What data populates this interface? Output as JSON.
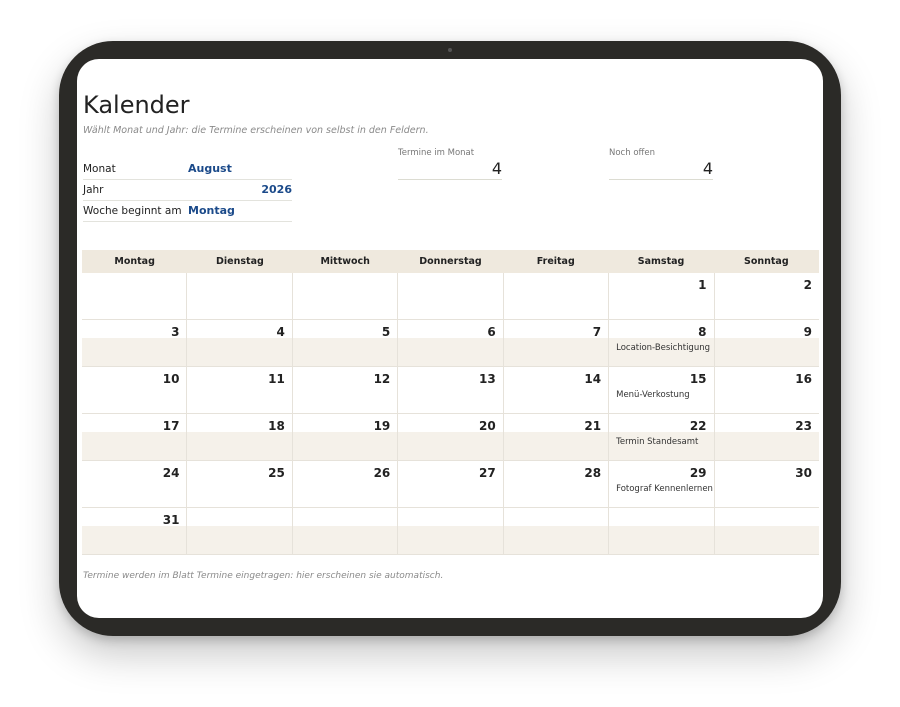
{
  "page": {
    "title": "Kalender",
    "subtitle": "Wählt Monat und Jahr: die Termine erscheinen von selbst in den Feldern.",
    "footer": "Termine werden im Blatt Termine eingetragen: hier erscheinen sie automatisch."
  },
  "fields": {
    "month_label": "Monat",
    "month_value": "August",
    "year_label": "Jahr",
    "year_value": "2026",
    "week_start_label": "Woche beginnt am",
    "week_start_value": "Montag"
  },
  "stats": {
    "appointments_label": "Termine im Monat",
    "appointments_value": "4",
    "open_label": "Noch offen",
    "open_value": "4"
  },
  "calendar": {
    "weekdays": [
      "Montag",
      "Dienstag",
      "Mittwoch",
      "Donnerstag",
      "Freitag",
      "Samstag",
      "Sonntag"
    ],
    "weeks": [
      [
        {
          "d": ""
        },
        {
          "d": ""
        },
        {
          "d": ""
        },
        {
          "d": ""
        },
        {
          "d": ""
        },
        {
          "d": "1"
        },
        {
          "d": "2"
        }
      ],
      [
        {
          "d": "3"
        },
        {
          "d": "4"
        },
        {
          "d": "5"
        },
        {
          "d": "6"
        },
        {
          "d": "7"
        },
        {
          "d": "8",
          "e": "Location-Besichtigung"
        },
        {
          "d": "9"
        }
      ],
      [
        {
          "d": "10"
        },
        {
          "d": "11"
        },
        {
          "d": "12"
        },
        {
          "d": "13"
        },
        {
          "d": "14"
        },
        {
          "d": "15",
          "e": "Menü-Verkostung"
        },
        {
          "d": "16"
        }
      ],
      [
        {
          "d": "17"
        },
        {
          "d": "18"
        },
        {
          "d": "19"
        },
        {
          "d": "20"
        },
        {
          "d": "21"
        },
        {
          "d": "22",
          "e": "Termin Standesamt"
        },
        {
          "d": "23"
        }
      ],
      [
        {
          "d": "24"
        },
        {
          "d": "25"
        },
        {
          "d": "26"
        },
        {
          "d": "27"
        },
        {
          "d": "28"
        },
        {
          "d": "29",
          "e": "Fotograf Kennenlernen"
        },
        {
          "d": "30"
        }
      ],
      [
        {
          "d": "31"
        },
        {
          "d": ""
        },
        {
          "d": ""
        },
        {
          "d": ""
        },
        {
          "d": ""
        },
        {
          "d": ""
        },
        {
          "d": ""
        }
      ]
    ]
  }
}
